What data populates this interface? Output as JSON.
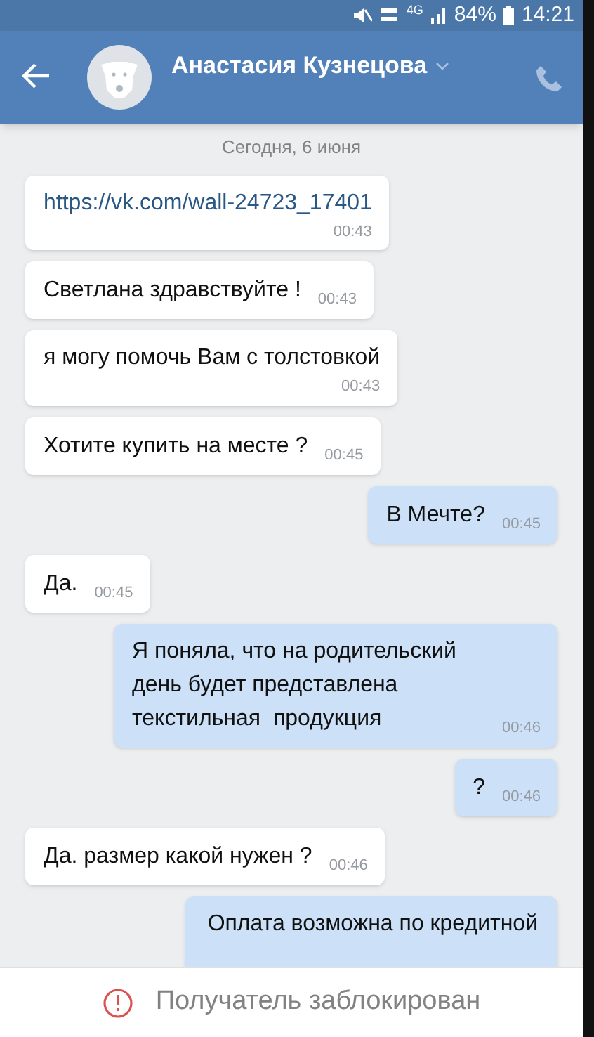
{
  "status_bar": {
    "battery": "84%",
    "time": "14:21",
    "network": "4G"
  },
  "header": {
    "contact_name": "Анастасия Кузнецова"
  },
  "date_separator": "Сегодня, 6 июня",
  "messages": [
    {
      "outgoing": false,
      "kind": "stacked",
      "text": "https://vk.com/wall-24723_17401",
      "link": true,
      "time": "00:43"
    },
    {
      "outgoing": false,
      "kind": "inline",
      "text": "Светлана здравствуйте !",
      "link": false,
      "time": "00:43"
    },
    {
      "outgoing": false,
      "kind": "stacked",
      "text": "я могу помочь Вам с толстовкой",
      "link": false,
      "time": "00:43"
    },
    {
      "outgoing": false,
      "kind": "inline",
      "text": "Хотите купить на месте ?",
      "link": false,
      "time": "00:45"
    },
    {
      "outgoing": true,
      "kind": "inline",
      "text": "В Мечте?",
      "link": false,
      "time": "00:45"
    },
    {
      "outgoing": false,
      "kind": "inline",
      "text": "Да.",
      "link": false,
      "time": "00:45"
    },
    {
      "outgoing": true,
      "kind": "inline",
      "text": "Я поняла, что на родительский день будет представлена текстильная  продукция",
      "link": false,
      "time": "00:46"
    },
    {
      "outgoing": true,
      "kind": "inline",
      "text": "?",
      "link": false,
      "time": "00:46"
    },
    {
      "outgoing": false,
      "kind": "inline",
      "text": "Да. размер какой нужен ?",
      "link": false,
      "time": "00:46"
    },
    {
      "outgoing": true,
      "kind": "cut",
      "text": "Оплата возможна по кредитной",
      "link": false
    }
  ],
  "blocked_notice": "Получатель заблокирован"
}
